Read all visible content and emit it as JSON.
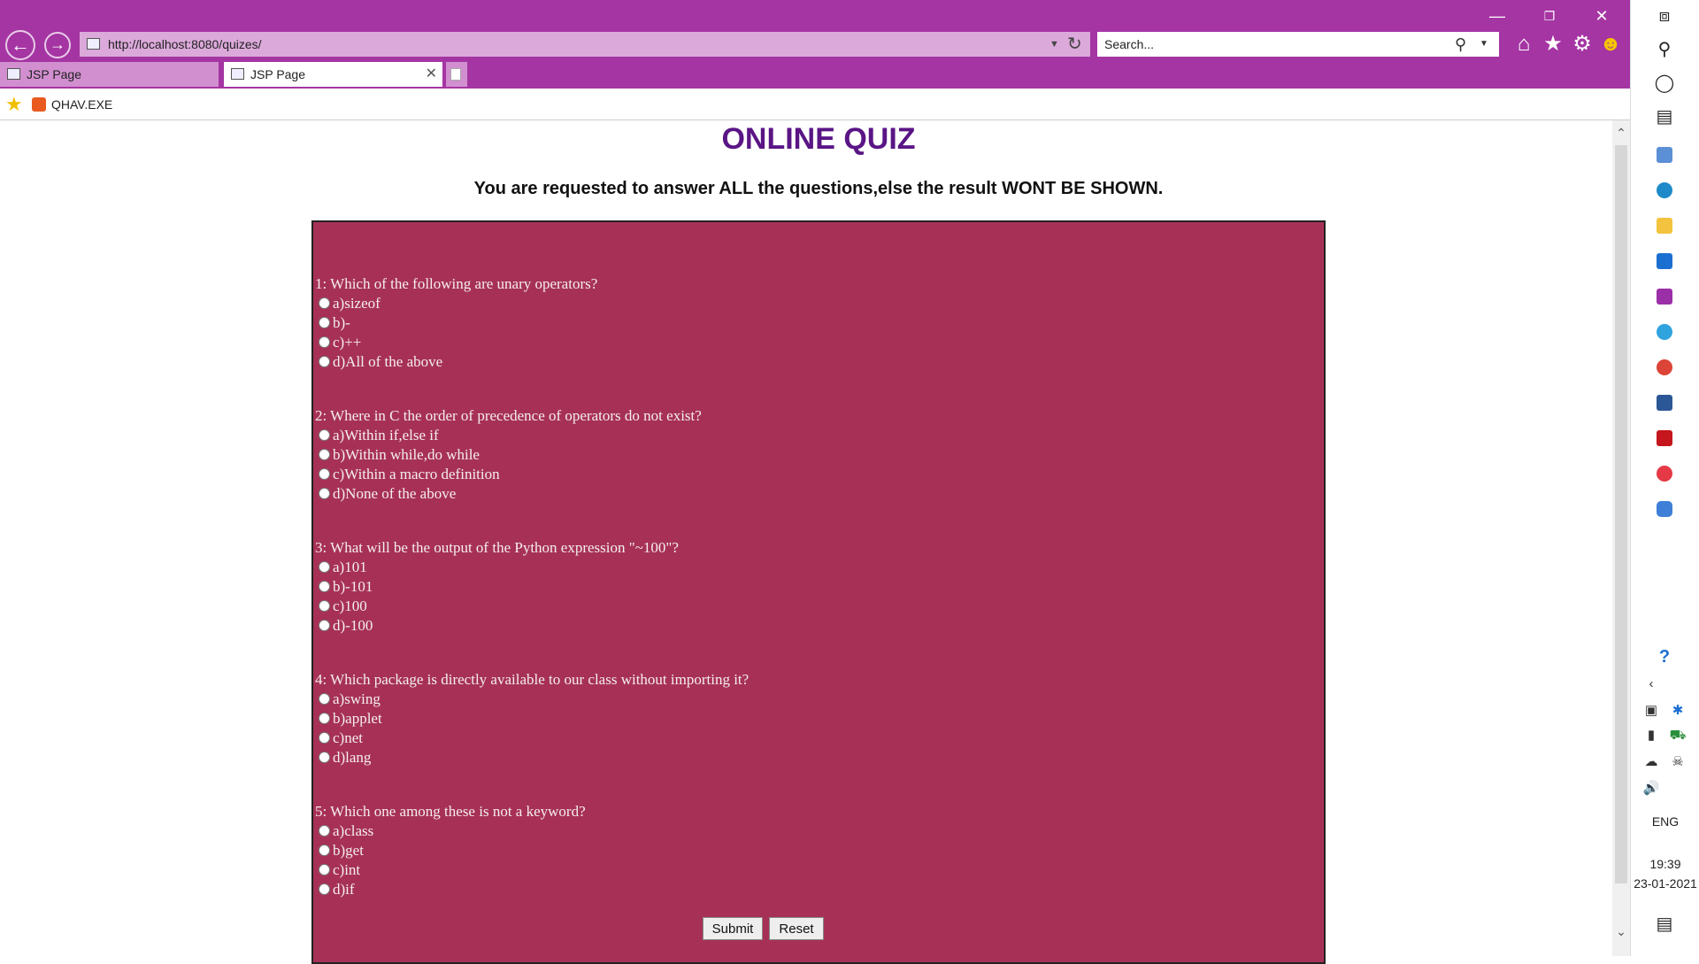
{
  "browser": {
    "address": "http://localhost:8080/quizes/",
    "search_placeholder": "Search...",
    "tabs": [
      {
        "label": "JSP Page"
      },
      {
        "label": "JSP Page"
      }
    ],
    "favorites": {
      "label": "QHAV.EXE"
    },
    "theme_color": "#a535a3"
  },
  "page": {
    "title": "ONLINE QUIZ",
    "instructions": "You are requested to answer ALL the questions,else the result WONT BE SHOWN.",
    "box_color": "#a73156",
    "questions": [
      {
        "text": "1: Which of the following are unary operators?",
        "options": [
          "a)sizeof",
          "b)-",
          "c)++",
          "d)All of the above"
        ]
      },
      {
        "text": "2: Where in C the order of precedence of operators do not exist?",
        "options": [
          "a)Within if,else if",
          "b)Within while,do while",
          "c)Within a macro definition",
          "d)None of the above"
        ]
      },
      {
        "text": "3: What will be the output of the Python expression \"~100\"?",
        "options": [
          "a)101",
          "b)-101",
          "c)100",
          "d)-100"
        ]
      },
      {
        "text": "4: Which package is directly available to our class without importing it?",
        "options": [
          "a)swing",
          "b)applet",
          "c)net",
          "d)lang"
        ]
      },
      {
        "text": "5: Which one among these is not a keyword?",
        "options": [
          "a)class",
          "b)get",
          "c)int",
          "d)if"
        ]
      }
    ],
    "submit_label": "Submit",
    "reset_label": "Reset"
  },
  "taskbar": {
    "language": "ENG",
    "time": "19:39",
    "date": "23-01-2021"
  }
}
